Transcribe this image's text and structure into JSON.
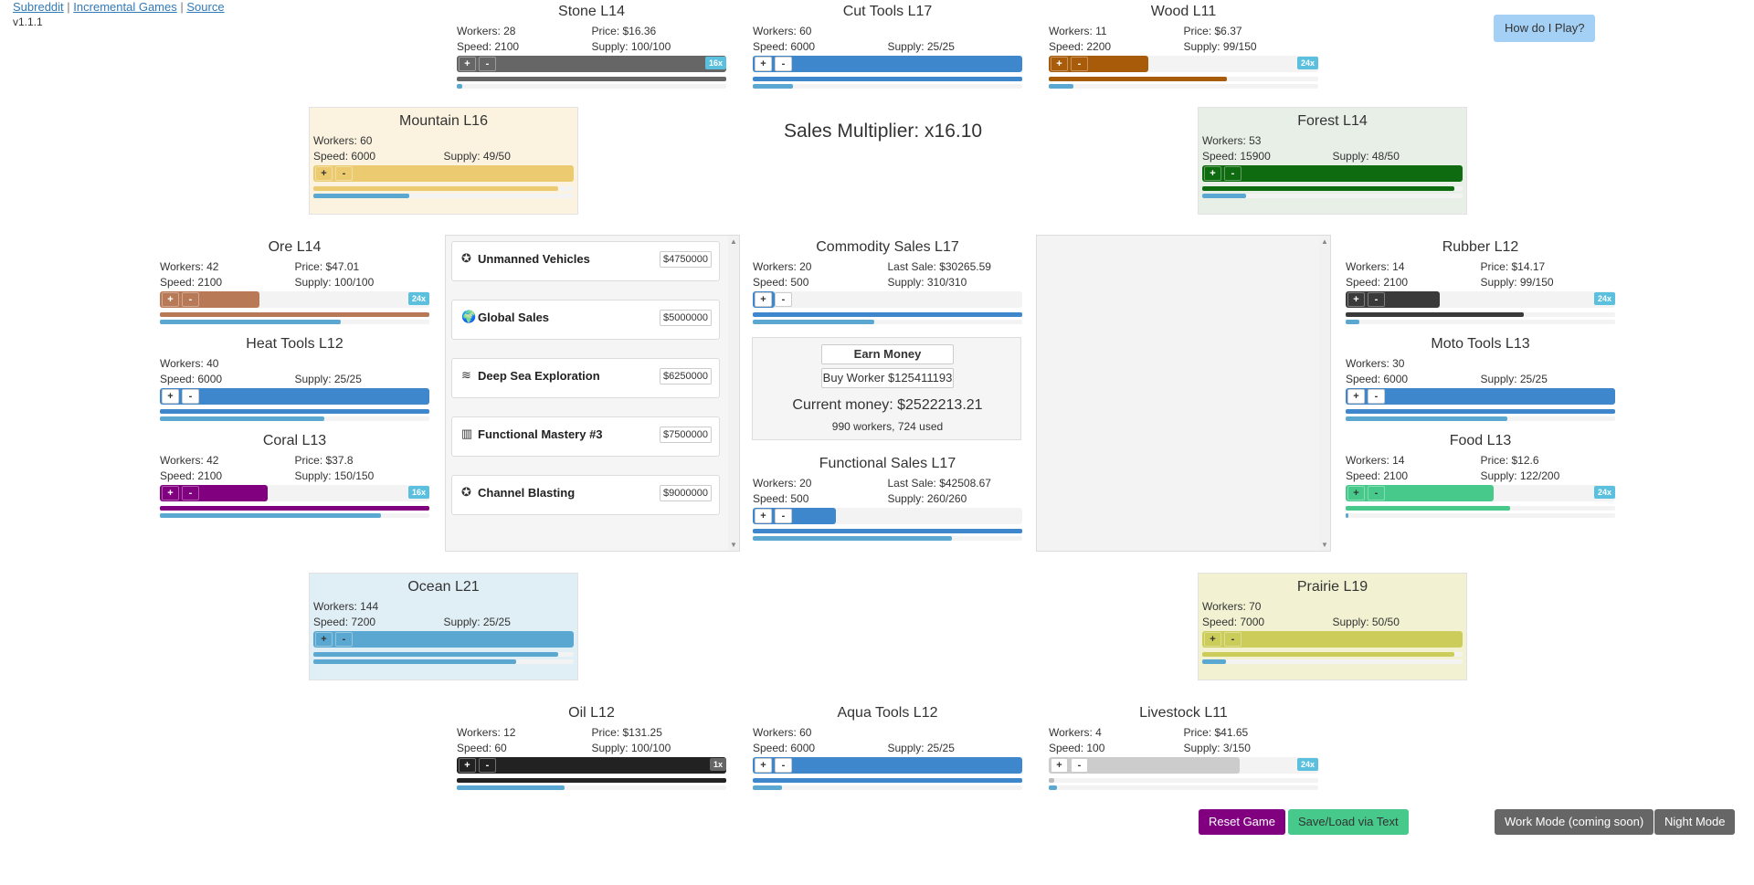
{
  "links": {
    "subreddit": "Subreddit",
    "incremental": "Incremental Games",
    "source": "Source",
    "sep": "|"
  },
  "version": "v1.1.1",
  "how_button": "How do I Play?",
  "multiplier": "Sales Multiplier: x16.10",
  "cards": {
    "stone": {
      "title": "Stone L14",
      "workers": "Workers: 28",
      "price": "Price: $16.36",
      "speed": "Speed: 2100",
      "supply": "Supply: 100/100",
      "mult": "16x",
      "color": "#666666",
      "progress": 1.0,
      "t1": 1.0,
      "t2": 0.02
    },
    "cut_tools": {
      "title": "Cut Tools L17",
      "workers": "Workers: 60",
      "speed": "Speed: 6000",
      "supply": "Supply: 25/25",
      "color": "#3f87cc",
      "progress": 1.0,
      "t1": 1.0,
      "t2": 0.15
    },
    "wood": {
      "title": "Wood L11",
      "workers": "Workers: 11",
      "price": "Price: $6.37",
      "speed": "Speed: 2200",
      "supply": "Supply: 99/150",
      "mult": "24x",
      "color": "#a85c0a",
      "progress": 0.37,
      "t1": 0.66,
      "t2": 0.09
    },
    "mountain": {
      "title": "Mountain L16",
      "workers": "Workers: 60",
      "speed": "Speed: 6000",
      "supply": "Supply: 49/50",
      "color": "#eccb70",
      "bg": "#fbf3e0",
      "progress": 1.0,
      "t1": 0.94,
      "t2": 0.37
    },
    "forest": {
      "title": "Forest L14",
      "workers": "Workers: 53",
      "speed": "Speed: 15900",
      "supply": "Supply: 48/50",
      "color": "#0f6b0f",
      "bg": "#e7efe7",
      "progress": 1.0,
      "t1": 0.97,
      "t2": 0.17
    },
    "ore": {
      "title": "Ore L14",
      "workers": "Workers: 42",
      "price": "Price: $47.01",
      "speed": "Speed: 2100",
      "supply": "Supply: 100/100",
      "mult": "24x",
      "color": "#b87a56",
      "progress": 0.37,
      "t1": 1.0,
      "t2": 0.67
    },
    "heat_tools": {
      "title": "Heat Tools L12",
      "workers": "Workers: 40",
      "speed": "Speed: 6000",
      "supply": "Supply: 25/25",
      "color": "#3f87cc",
      "progress": 1.0,
      "t1": 1.0,
      "t2": 0.61
    },
    "coral": {
      "title": "Coral L13",
      "workers": "Workers: 42",
      "price": "Price: $37.8",
      "speed": "Speed: 2100",
      "supply": "Supply: 150/150",
      "mult": "16x",
      "color": "#800080",
      "progress": 0.4,
      "t1": 1.0,
      "t2": 0.82
    },
    "rubber": {
      "title": "Rubber L12",
      "workers": "Workers: 14",
      "price": "Price: $14.17",
      "speed": "Speed: 2100",
      "supply": "Supply: 99/150",
      "mult": "24x",
      "color": "#3a3a3a",
      "progress": 0.35,
      "t1": 0.66,
      "t2": 0.05
    },
    "moto_tools": {
      "title": "Moto Tools L13",
      "workers": "Workers: 30",
      "speed": "Speed: 6000",
      "supply": "Supply: 25/25",
      "color": "#3f87cc",
      "progress": 1.0,
      "t1": 1.0,
      "t2": 0.6
    },
    "food": {
      "title": "Food L13",
      "workers": "Workers: 14",
      "price": "Price: $12.6",
      "speed": "Speed: 2100",
      "supply": "Supply: 122/200",
      "mult": "24x",
      "color": "#46c98a",
      "progress": 0.55,
      "t1": 0.61,
      "t2": 0.01
    },
    "ocean": {
      "title": "Ocean L21",
      "workers": "Workers: 144",
      "speed": "Speed: 7200",
      "supply": "Supply: 25/25",
      "color": "#5aa8d2",
      "bg": "#e0eef5",
      "progress": 1.0,
      "t1": 0.94,
      "t2": 0.78
    },
    "prairie": {
      "title": "Prairie L19",
      "workers": "Workers: 70",
      "speed": "Speed: 7000",
      "supply": "Supply: 50/50",
      "color": "#cccc5a",
      "bg": "#f2f2d2",
      "progress": 1.0,
      "t1": 0.97,
      "t2": 0.09
    },
    "oil": {
      "title": "Oil L12",
      "workers": "Workers: 12",
      "price": "Price: $131.25",
      "speed": "Speed: 60",
      "supply": "Supply: 100/100",
      "mult": "1x",
      "multcolor": "#666666",
      "color": "#222222",
      "progress": 1.0,
      "t1": 1.0,
      "t2": 0.4
    },
    "aqua_tools": {
      "title": "Aqua Tools L12",
      "workers": "Workers: 60",
      "speed": "Speed: 6000",
      "supply": "Supply: 25/25",
      "color": "#3f87cc",
      "progress": 1.0,
      "t1": 1.0,
      "t2": 0.11
    },
    "livestock": {
      "title": "Livestock L11",
      "workers": "Workers: 4",
      "price": "Price: $41.65",
      "speed": "Speed: 100",
      "supply": "Supply: 3/150",
      "mult": "24x",
      "color": "#cccccc",
      "progress": 0.71,
      "t1": 0.02,
      "t2": 0.03
    },
    "commodity": {
      "title": "Commodity Sales L17",
      "workers": "Workers: 20",
      "price": "Last Sale: $30265.59",
      "speed": "Speed: 500",
      "supply": "Supply: 310/310",
      "color": "#3f87cc",
      "progress": 0.08,
      "t1": 1.0,
      "t2": 0.45
    },
    "functional": {
      "title": "Functional Sales L17",
      "workers": "Workers: 20",
      "price": "Last Sale: $42508.67",
      "speed": "Speed: 500",
      "supply": "Supply: 260/260",
      "color": "#3f87cc",
      "progress": 0.31,
      "t1": 1.0,
      "t2": 0.74
    }
  },
  "plus": "+",
  "minus": "-",
  "upgrades": [
    {
      "icon": "✪",
      "name": "Unmanned Vehicles",
      "price": "$4750000"
    },
    {
      "icon": "🌍",
      "name": "Global Sales",
      "price": "$5000000"
    },
    {
      "icon": "≋",
      "name": "Deep Sea Exploration",
      "price": "$6250000"
    },
    {
      "icon": "▥",
      "name": "Functional Mastery #3",
      "price": "$7500000"
    },
    {
      "icon": "✪",
      "name": "Channel Blasting",
      "price": "$9000000"
    }
  ],
  "money": {
    "earn": "Earn Money",
    "buy": "Buy Worker $125411193",
    "current": "Current money: $2522213.21",
    "workers": "990 workers, 724 used"
  },
  "bottom_buttons": {
    "reset": "Reset Game",
    "save": "Save/Load via Text",
    "work": "Work Mode (coming soon)",
    "night": "Night Mode"
  },
  "colors": {
    "reset": "#800080",
    "save": "#46c98a",
    "work": "#666666",
    "night": "#666666"
  }
}
